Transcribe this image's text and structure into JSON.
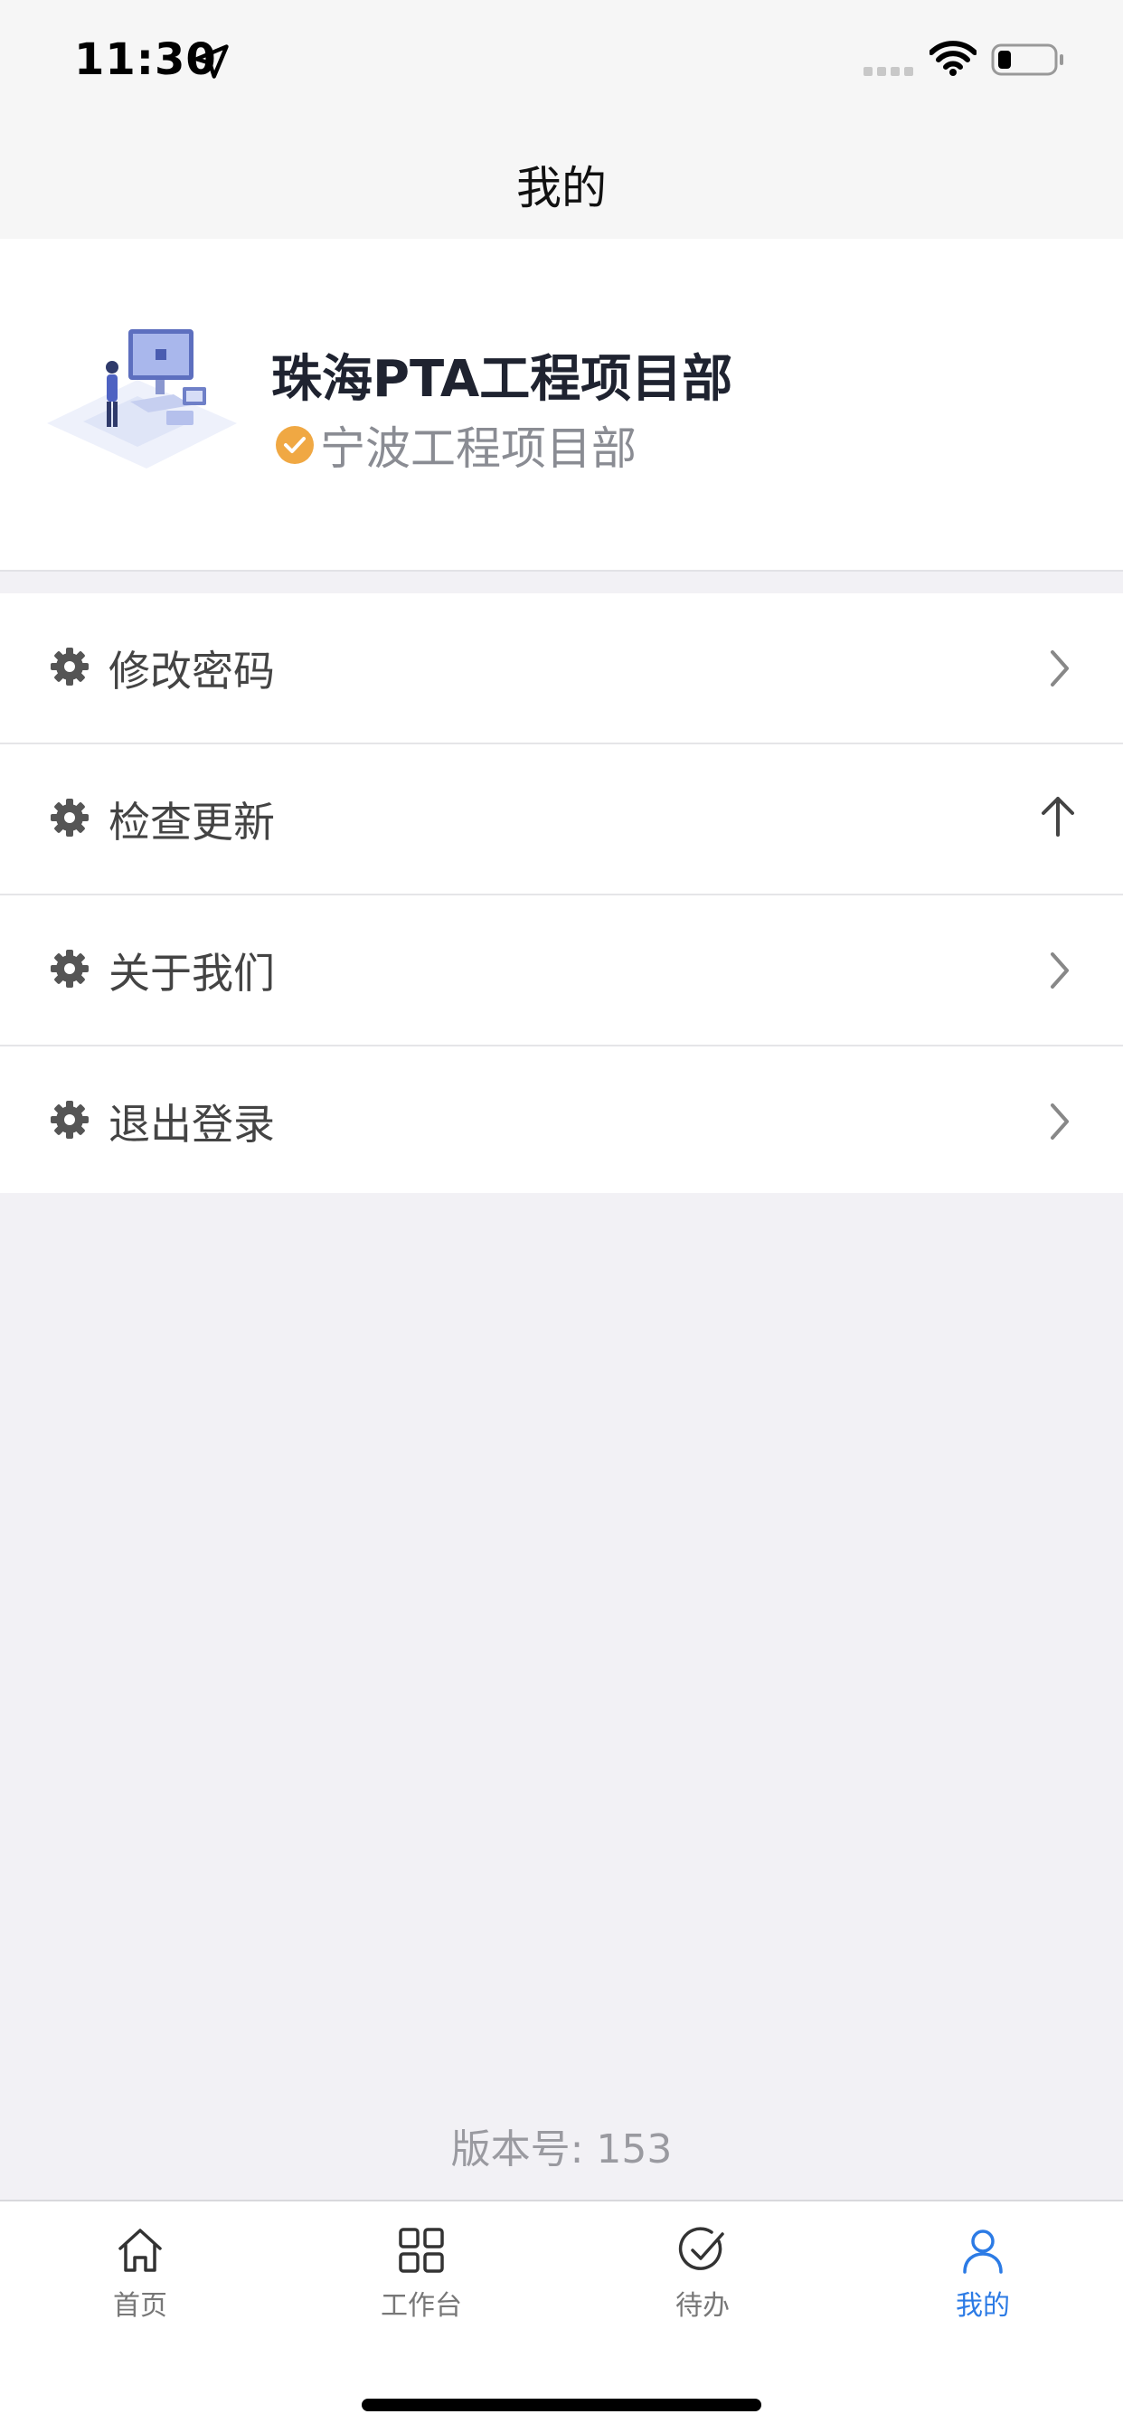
{
  "status_bar": {
    "time": "11:30"
  },
  "nav": {
    "title": "我的"
  },
  "profile": {
    "name": "珠海PTA工程项目部",
    "department": "宁波工程项目部",
    "badge_color": "#f0a843"
  },
  "menu": {
    "items": [
      {
        "label": "修改密码",
        "trailing": "chevron-right-icon"
      },
      {
        "label": "检查更新",
        "trailing": "arrow-up-icon"
      },
      {
        "label": "关于我们",
        "trailing": "chevron-right-icon"
      },
      {
        "label": "退出登录",
        "trailing": "chevron-right-icon"
      }
    ]
  },
  "version": {
    "text": "版本号: 153"
  },
  "tab_bar": {
    "active_color": "#2c7be5",
    "tabs": [
      {
        "label": "首页",
        "icon": "home-icon"
      },
      {
        "label": "工作台",
        "icon": "grid-icon"
      },
      {
        "label": "待办",
        "icon": "check-circle-icon"
      },
      {
        "label": "我的",
        "icon": "user-icon",
        "active": true
      }
    ]
  }
}
